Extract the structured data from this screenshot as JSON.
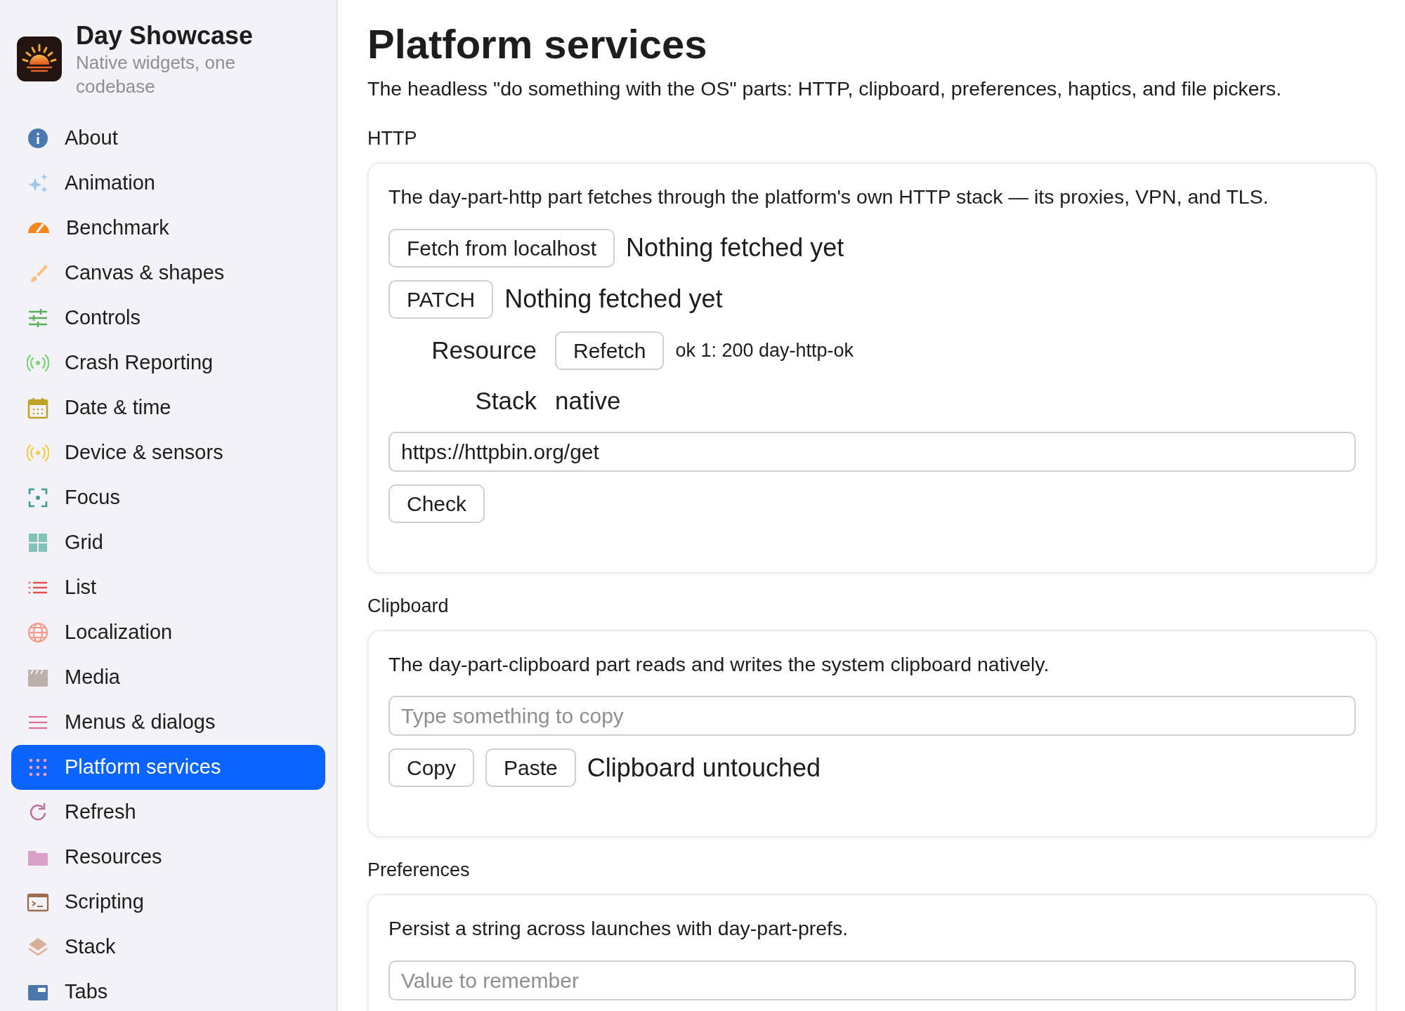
{
  "app": {
    "title": "Day Showcase",
    "subtitle": "Native widgets, one codebase"
  },
  "sidebar": {
    "items": [
      {
        "label": "About",
        "selected": false
      },
      {
        "label": "Animation",
        "selected": false
      },
      {
        "label": "Benchmark",
        "selected": false
      },
      {
        "label": "Canvas & shapes",
        "selected": false
      },
      {
        "label": "Controls",
        "selected": false
      },
      {
        "label": "Crash Reporting",
        "selected": false
      },
      {
        "label": "Date & time",
        "selected": false
      },
      {
        "label": "Device & sensors",
        "selected": false
      },
      {
        "label": "Focus",
        "selected": false
      },
      {
        "label": "Grid",
        "selected": false
      },
      {
        "label": "List",
        "selected": false
      },
      {
        "label": "Localization",
        "selected": false
      },
      {
        "label": "Media",
        "selected": false
      },
      {
        "label": "Menus & dialogs",
        "selected": false
      },
      {
        "label": "Platform services",
        "selected": true
      },
      {
        "label": "Refresh",
        "selected": false
      },
      {
        "label": "Resources",
        "selected": false
      },
      {
        "label": "Scripting",
        "selected": false
      },
      {
        "label": "Stack",
        "selected": false
      },
      {
        "label": "Tabs",
        "selected": false
      }
    ]
  },
  "page": {
    "title": "Platform services",
    "description": "The headless \"do something with the OS\" parts: HTTP, clipboard, preferences, haptics, and file pickers."
  },
  "sections": [
    {
      "heading": "HTTP",
      "description": "The day-part-http part fetches through the platform's own HTTP stack — its proxies, VPN, and TLS.",
      "rows": [
        {
          "kind": "actions",
          "buttons": [
            "Fetch from localhost"
          ],
          "status": "Nothing fetched yet"
        },
        {
          "kind": "actions",
          "buttons": [
            "PATCH"
          ],
          "status": "Nothing fetched yet"
        },
        {
          "kind": "labeled",
          "label": "Resource",
          "buttons": [
            "Refetch"
          ],
          "note": "ok 1: 200 day-http-ok"
        },
        {
          "kind": "labeled",
          "label": "Stack",
          "value": "native"
        },
        {
          "kind": "input",
          "value": "https://httpbin.org/get"
        },
        {
          "kind": "actions",
          "buttons": [
            "Check"
          ]
        }
      ]
    },
    {
      "heading": "Clipboard",
      "description": "The day-part-clipboard part reads and writes the system clipboard natively.",
      "rows": [
        {
          "kind": "input",
          "placeholder": "Type something to copy"
        },
        {
          "kind": "actions",
          "buttons": [
            "Copy",
            "Paste"
          ],
          "status": "Clipboard untouched"
        }
      ]
    },
    {
      "heading": "Preferences",
      "description": "Persist a string across launches with day-part-prefs.",
      "rows": [
        {
          "kind": "input",
          "placeholder": "Value to remember"
        }
      ]
    }
  ]
}
